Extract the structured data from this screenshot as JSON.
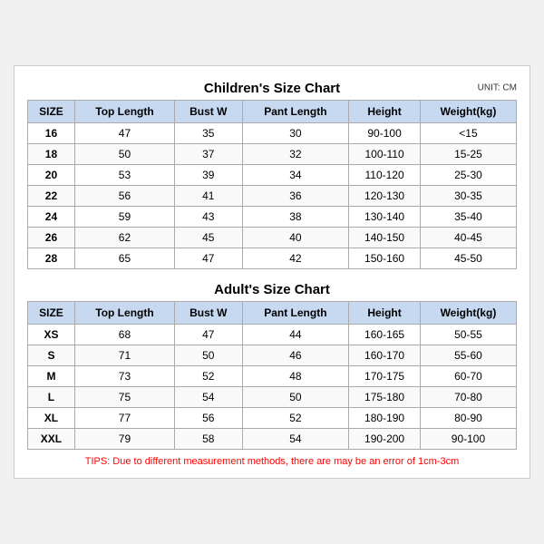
{
  "children_chart": {
    "title": "Children's Size Chart",
    "unit": "UNIT: CM",
    "headers": [
      "SIZE",
      "Top Length",
      "Bust W",
      "Pant Length",
      "Height",
      "Weight(kg)"
    ],
    "rows": [
      [
        "16",
        "47",
        "35",
        "30",
        "90-100",
        "<15"
      ],
      [
        "18",
        "50",
        "37",
        "32",
        "100-110",
        "15-25"
      ],
      [
        "20",
        "53",
        "39",
        "34",
        "110-120",
        "25-30"
      ],
      [
        "22",
        "56",
        "41",
        "36",
        "120-130",
        "30-35"
      ],
      [
        "24",
        "59",
        "43",
        "38",
        "130-140",
        "35-40"
      ],
      [
        "26",
        "62",
        "45",
        "40",
        "140-150",
        "40-45"
      ],
      [
        "28",
        "65",
        "47",
        "42",
        "150-160",
        "45-50"
      ]
    ]
  },
  "adults_chart": {
    "title": "Adult's Size Chart",
    "headers": [
      "SIZE",
      "Top Length",
      "Bust W",
      "Pant Length",
      "Height",
      "Weight(kg)"
    ],
    "rows": [
      [
        "XS",
        "68",
        "47",
        "44",
        "160-165",
        "50-55"
      ],
      [
        "S",
        "71",
        "50",
        "46",
        "160-170",
        "55-60"
      ],
      [
        "M",
        "73",
        "52",
        "48",
        "170-175",
        "60-70"
      ],
      [
        "L",
        "75",
        "54",
        "50",
        "175-180",
        "70-80"
      ],
      [
        "XL",
        "77",
        "56",
        "52",
        "180-190",
        "80-90"
      ],
      [
        "XXL",
        "79",
        "58",
        "54",
        "190-200",
        "90-100"
      ]
    ]
  },
  "tips": "TIPS: Due to different measurement methods, there are may be an error of 1cm-3cm"
}
